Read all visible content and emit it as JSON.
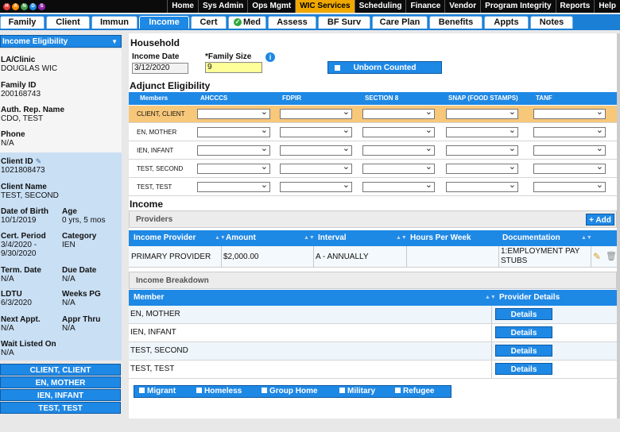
{
  "logo": {
    "letters": [
      "H",
      "A",
      "N",
      "D",
      "S"
    ]
  },
  "top_menu": [
    "Home",
    "Sys Admin",
    "Ops Mgmt",
    "WIC Services",
    "Scheduling",
    "Finance",
    "Vendor",
    "Program Integrity",
    "Reports",
    "Help"
  ],
  "active_menu": "WIC Services",
  "tabs": [
    "Family",
    "Client",
    "Immun",
    "Income",
    "Cert",
    "Med",
    "Assess",
    "BF Surv",
    "Care Plan",
    "Benefits",
    "Appts",
    "Notes"
  ],
  "active_tab": "Income",
  "sidebar": {
    "selector": "Income Eligibility",
    "la_clinic_label": "LA/Clinic",
    "la_clinic": "DOUGLAS WIC",
    "family_id_label": "Family ID",
    "family_id": "200168743",
    "auth_rep_label": "Auth. Rep. Name",
    "auth_rep": "CDO, TEST",
    "phone_label": "Phone",
    "phone": "N/A",
    "client_id_label": "Client ID",
    "client_id": "1021808473",
    "client_name_label": "Client Name",
    "client_name": "TEST, SECOND",
    "dob_label": "Date of Birth",
    "dob": "10/1/2019",
    "age_label": "Age",
    "age": "0 yrs, 5 mos",
    "cert_period_label": "Cert. Period",
    "cert_period_line1": "3/4/2020 -",
    "cert_period_line2": "9/30/2020",
    "category_label": "Category",
    "category": "IEN",
    "term_date_label": "Term. Date",
    "term_date": "N/A",
    "due_date_label": "Due Date",
    "due_date": "N/A",
    "ldtu_label": "LDTU",
    "ldtu": "6/3/2020",
    "weeks_pg_label": "Weeks PG",
    "weeks_pg": "N/A",
    "next_appt_label": "Next Appt.",
    "next_appt": "N/A",
    "appr_thru_label": "Appr Thru",
    "appr_thru": "N/A",
    "wait_listed_label": "Wait Listed On",
    "wait_listed": "N/A",
    "members": [
      "CLIENT, CLIENT",
      "EN, MOTHER",
      "IEN, INFANT",
      "TEST, TEST"
    ]
  },
  "household": {
    "title": "Household",
    "income_date_label": "Income Date",
    "income_date": "3/12/2020",
    "family_size_label": "*Family Size",
    "family_size": "9",
    "info_icon": "i",
    "unborn_label": "Unborn Counted"
  },
  "adjunct": {
    "title": "Adjunct Eligibility",
    "columns": [
      "Members",
      "AHCCCS",
      "FDPIR",
      "SECTION 8",
      "SNAP (FOOD STAMPS)",
      "TANF"
    ],
    "rows": [
      "CLIENT, CLIENT",
      "EN, MOTHER",
      "IEN, INFANT",
      "TEST, SECOND",
      "TEST, TEST"
    ]
  },
  "income": {
    "title": "Income",
    "providers_label": "Providers",
    "add_label": "Add",
    "columns": [
      "Income Provider",
      "Amount",
      "Interval",
      "Hours Per Week",
      "Documentation"
    ],
    "rows": [
      {
        "provider": "PRIMARY PROVIDER",
        "amount": "$2,000.00",
        "interval": "A - ANNUALLY",
        "hours": "",
        "documentation_line1": "1:EMPLOYMENT PAY",
        "documentation_line2": "STUBS"
      }
    ],
    "breakdown_label": "Income Breakdown",
    "breakdown_columns": [
      "Member",
      "Provider Details"
    ],
    "breakdown_rows": [
      "EN, MOTHER",
      "IEN, INFANT",
      "TEST, SECOND",
      "TEST, TEST"
    ],
    "details_label": "Details"
  },
  "flags": [
    "Migrant",
    "Homeless",
    "Group Home",
    "Military",
    "Refugee"
  ],
  "colors": {
    "accent": "#1e88e5",
    "highlight_row": "#f7c77a",
    "active_menu": "#f0a800",
    "family_size_bg": "#ffff99"
  }
}
